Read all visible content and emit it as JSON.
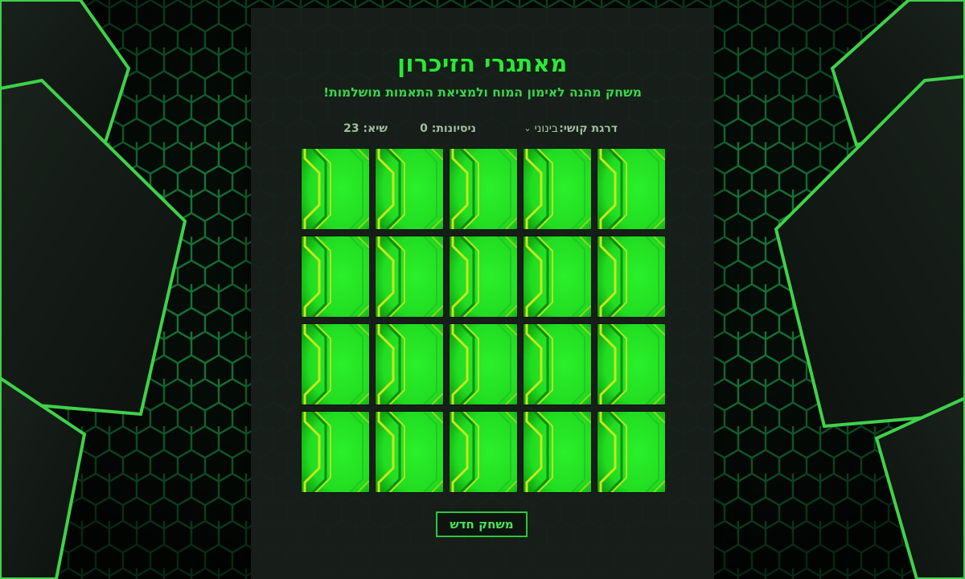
{
  "game": {
    "title": "מאתגרי הזיכרון",
    "subtitle": "משחק מהנה לאימון המוח ולמציאת התאמות מושלמות!"
  },
  "stats": {
    "difficulty_label": "דרגת קושי:",
    "difficulty_value": "בינוני",
    "attempts_text": "ניסיונות: 0",
    "best_text": "שיא: 23"
  },
  "board": {
    "rows": 4,
    "columns": 5,
    "cards_face_down": 20
  },
  "actions": {
    "new_game_label": "משחק חדש"
  },
  "colors": {
    "accent": "#2ee63a",
    "card_green": "#22dd22",
    "card_stripe": "#c8e61e",
    "panel": "#181e1a",
    "hex_line": "#1fae50"
  }
}
